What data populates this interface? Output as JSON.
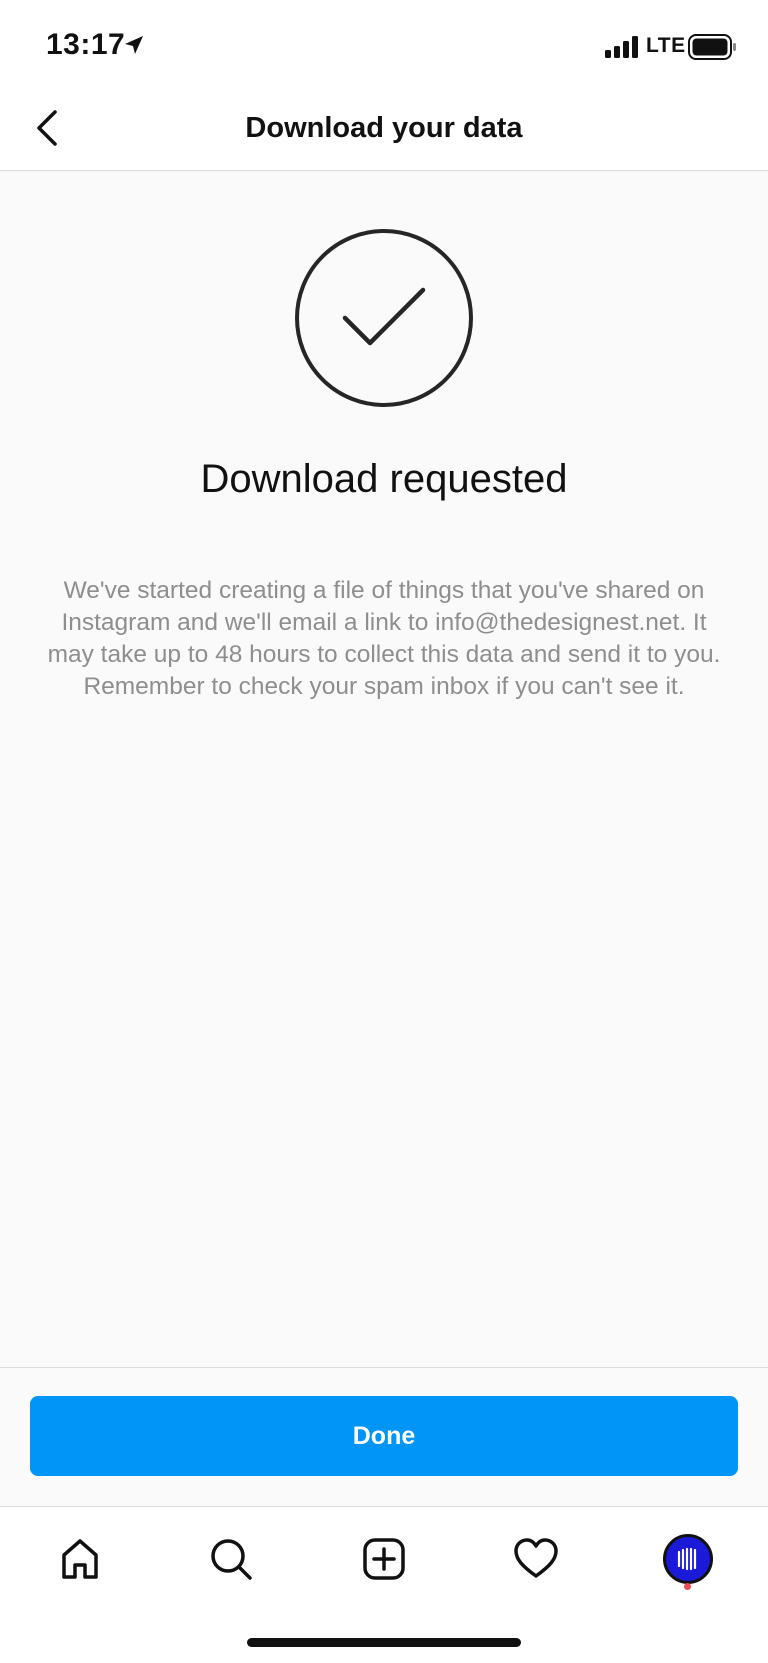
{
  "status_bar": {
    "time": "13:17",
    "network": "LTE",
    "icons": [
      "location-arrow-icon",
      "signal-icon",
      "battery-icon"
    ]
  },
  "header": {
    "title": "Download your data",
    "back_icon": "chevron-left-icon"
  },
  "main": {
    "status_icon": "check-circle-icon",
    "headline": "Download requested",
    "description": "We've started creating a file of things that you've shared on Instagram and we'll email a link to info@thedesignest.net. It may take up to 48 hours to collect this data and send it to you. Remember to check your spam inbox if you can't see it."
  },
  "footer": {
    "done_label": "Done"
  },
  "tab_bar": {
    "items": [
      {
        "icon": "home-icon"
      },
      {
        "icon": "search-icon"
      },
      {
        "icon": "plus-square-icon"
      },
      {
        "icon": "heart-icon"
      },
      {
        "icon": "profile-avatar"
      }
    ]
  },
  "colors": {
    "accent": "#0095f6",
    "background": "#fafafa",
    "secondary_text": "#8e8e8e",
    "notification_dot": "#ed4956",
    "avatar": "#1a1ad8"
  }
}
